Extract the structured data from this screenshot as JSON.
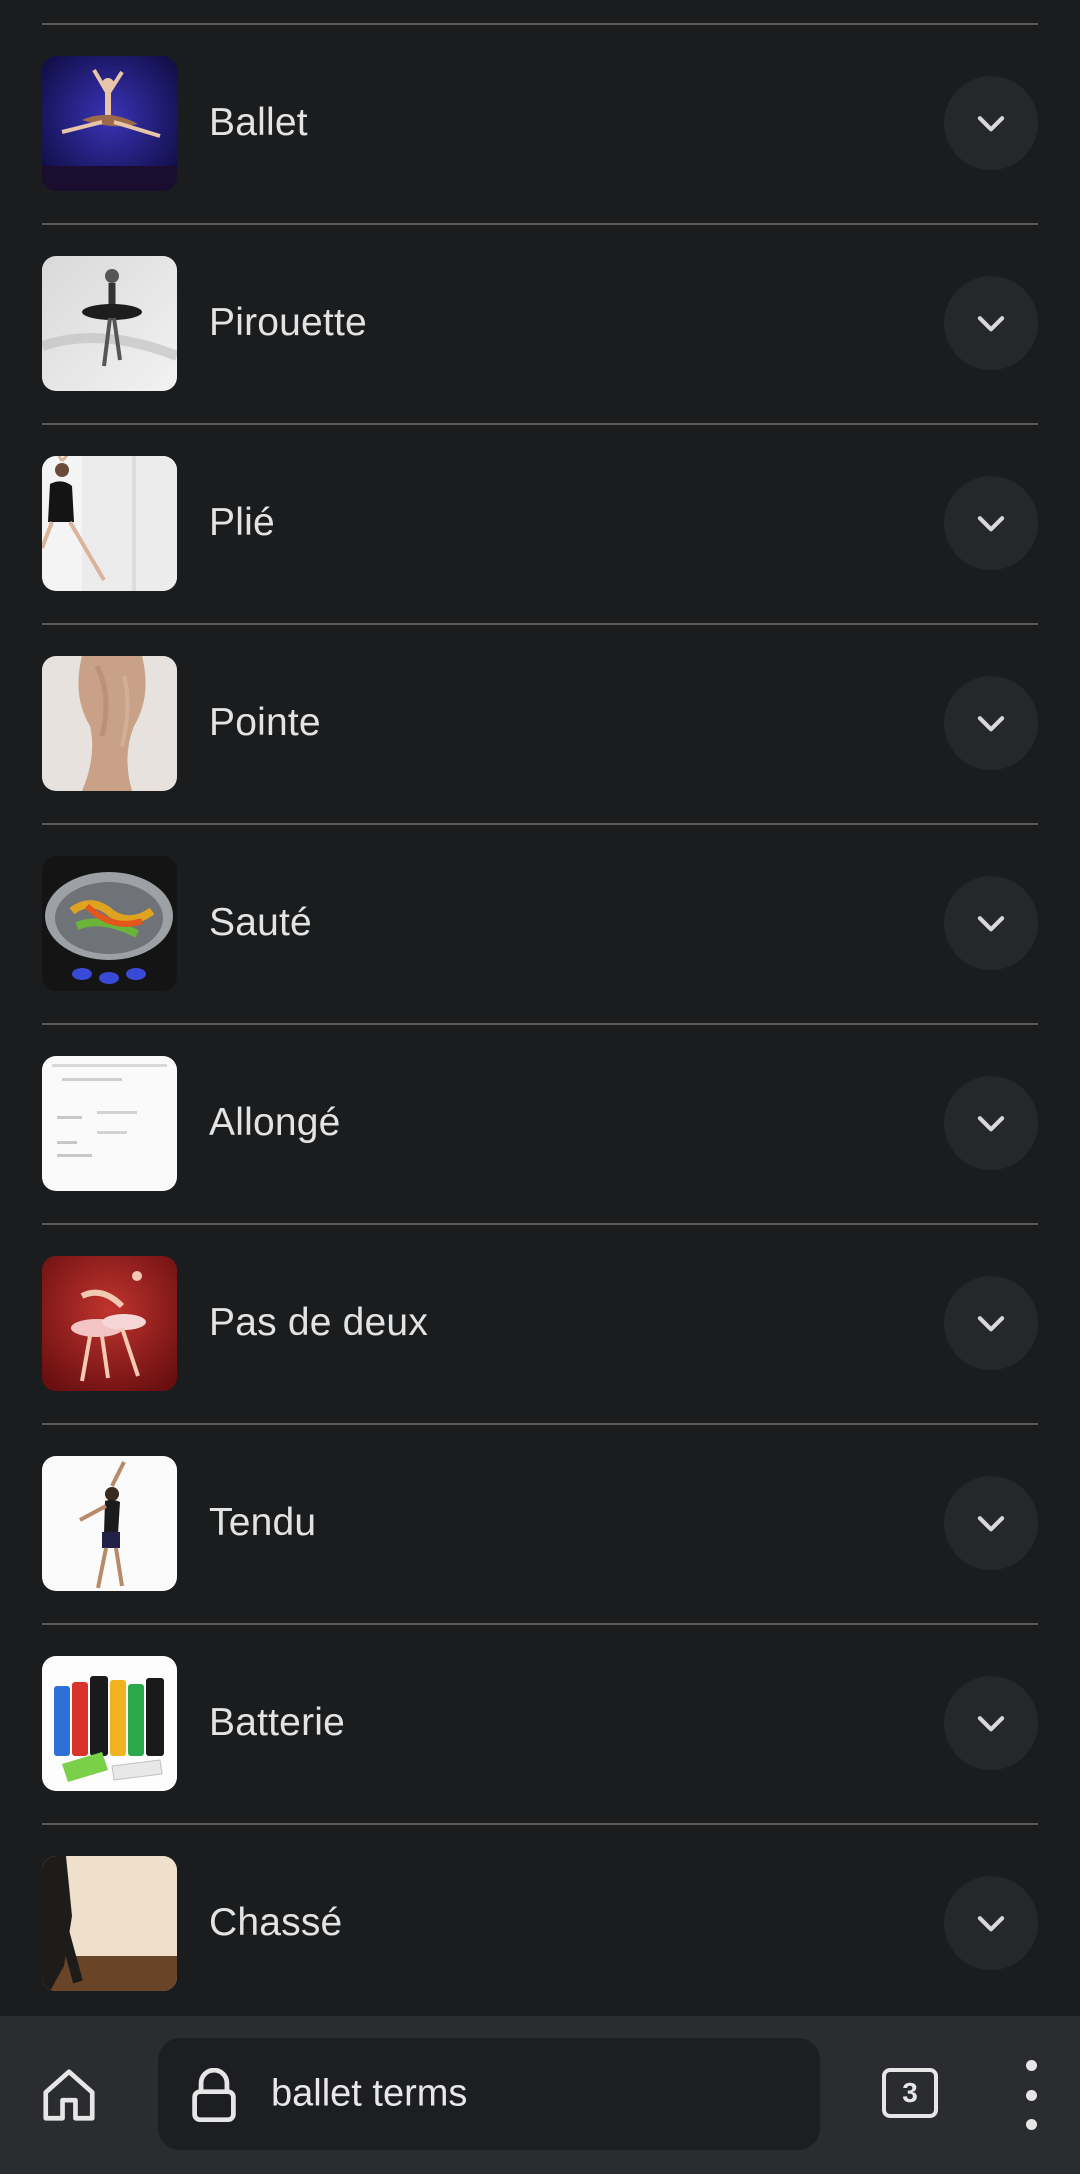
{
  "results": [
    {
      "label": "Ballet",
      "thumb": "ballet"
    },
    {
      "label": "Pirouette",
      "thumb": "pirouette"
    },
    {
      "label": "Plié",
      "thumb": "plie"
    },
    {
      "label": "Pointe",
      "thumb": "pointe"
    },
    {
      "label": "Sauté",
      "thumb": "saute"
    },
    {
      "label": "Allongé",
      "thumb": "allonge"
    },
    {
      "label": "Pas de deux",
      "thumb": "pasdedeux"
    },
    {
      "label": "Tendu",
      "thumb": "tendu"
    },
    {
      "label": "Batterie",
      "thumb": "batterie"
    },
    {
      "label": "Chassé",
      "thumb": "chasse"
    }
  ],
  "icons": {
    "expand": "chevron-down-icon",
    "home": "home-icon",
    "lock": "lock-icon",
    "menu": "more-vert-icon"
  },
  "omnibox": {
    "text": "ballet terms"
  },
  "tabs": {
    "count": "3"
  },
  "colors": {
    "background": "#1b1c1e",
    "divider": "#5b5a55",
    "button": "#26272a",
    "bar": "#2b2c30",
    "text": "#e3e3e3"
  }
}
